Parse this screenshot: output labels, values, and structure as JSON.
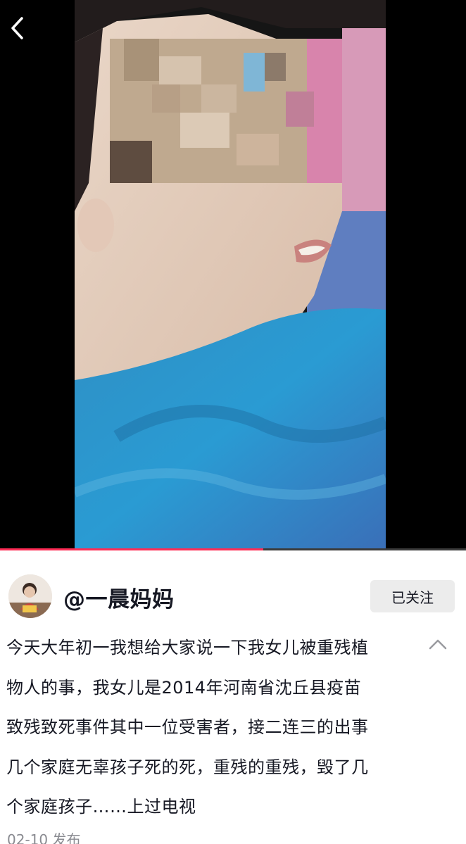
{
  "player": {
    "progress_fraction": 0.565,
    "accent_color": "#fe2c55",
    "back_icon": "chevron-left-icon"
  },
  "author": {
    "handle": "@一晨妈妈",
    "follow_label": "已关注"
  },
  "post": {
    "description_lines": [
      "今天大年初一我想给大家说一下我女儿被重残植",
      "物人的事，我女儿是2014年河南省沈丘县疫苗",
      "致残致死事件其中一位受害者，接二连三的出事",
      "几个家庭无辜孩子死的死，重残的重残，毁了几",
      "个家庭孩子……上过电视"
    ],
    "collapse_icon": "chevron-up-icon",
    "publish_time": "02-10 发布"
  }
}
